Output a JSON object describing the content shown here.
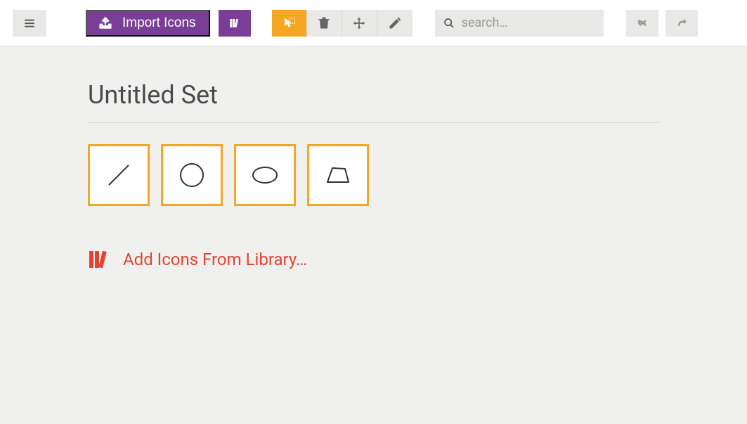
{
  "toolbar": {
    "import_label": "Import Icons",
    "search_placeholder": "search…"
  },
  "set": {
    "title": "Untitled Set",
    "icons": [
      {
        "name": "line-icon"
      },
      {
        "name": "circle-icon"
      },
      {
        "name": "ellipse-icon"
      },
      {
        "name": "trapezoid-icon"
      }
    ]
  },
  "add_library_label": "Add Icons From Library…"
}
